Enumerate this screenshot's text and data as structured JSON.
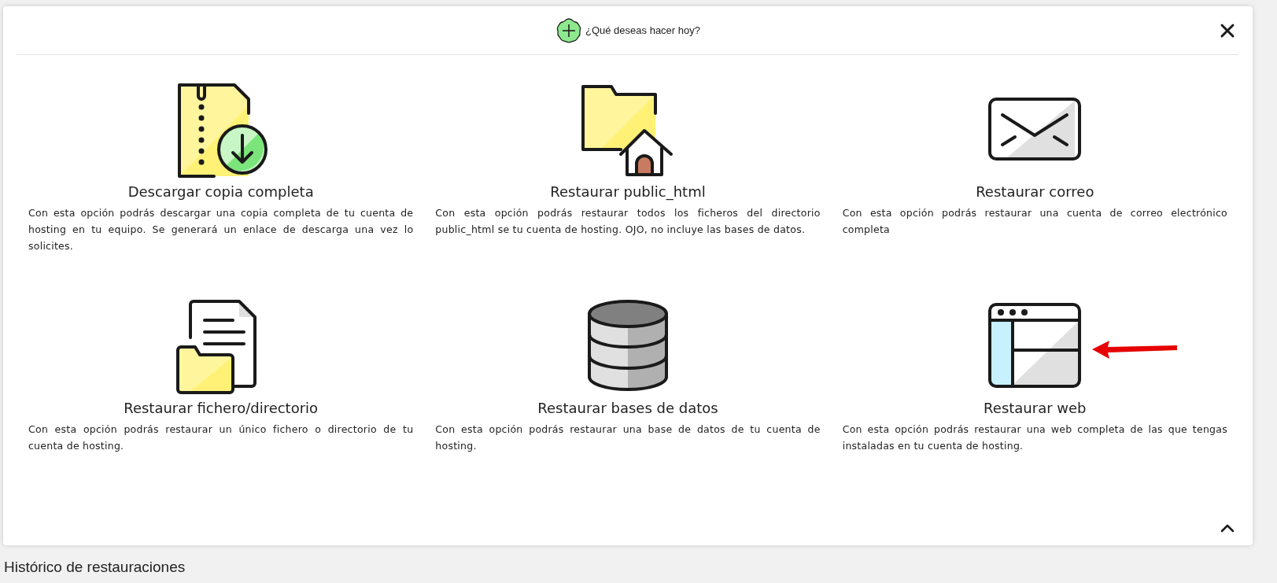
{
  "dialog": {
    "title": "¿Qué deseas hacer hoy?"
  },
  "options": [
    {
      "kind": "download",
      "title": "Descargar copia completa",
      "description": "Con esta opción podrás descargar una copia completa de tu cuenta de hosting en tu equipo. Se generará un enlace de descarga una vez lo solicites.",
      "pointed": false
    },
    {
      "kind": "public_html",
      "title": "Restaurar public_html",
      "description": "Con esta opción podrás restaurar todos los ficheros del directorio public_html se tu cuenta de hosting. OJO, no incluye las bases de datos.",
      "pointed": false
    },
    {
      "kind": "mail",
      "title": "Restaurar correo",
      "description": "Con esta opción podrás restaurar una cuenta de correo electrónico completa",
      "pointed": false
    },
    {
      "kind": "file",
      "title": "Restaurar fichero/directorio",
      "description": "Con esta opción podrás restaurar un único fichero o directorio de tu cuenta de hosting.",
      "pointed": false
    },
    {
      "kind": "database",
      "title": "Restaurar bases de datos",
      "description": "Con esta opción podrás restaurar una base de datos de tu cuenta de hosting.",
      "pointed": false
    },
    {
      "kind": "web",
      "title": "Restaurar web",
      "description": "Con esta opción podrás restaurar una web completa de las que tengas instaladas en tu cuenta de hosting.",
      "pointed": true
    }
  ],
  "history": {
    "heading": "Histórico de restauraciones"
  }
}
